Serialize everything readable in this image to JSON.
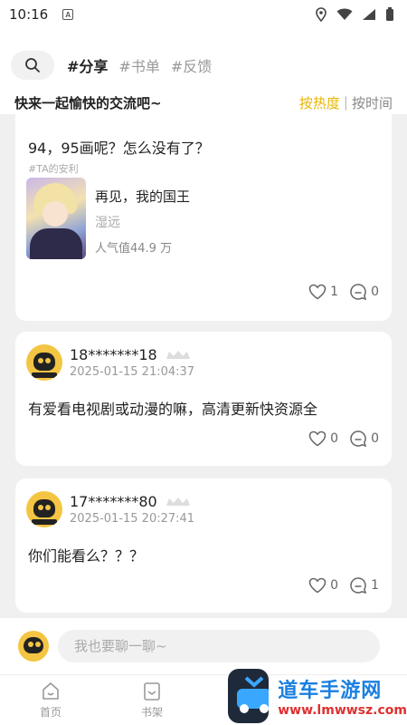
{
  "status": {
    "time": "10:16",
    "app_icon_glyph": "A"
  },
  "tabs": [
    {
      "label": "#分享",
      "active": true
    },
    {
      "label": "#书单",
      "active": false
    },
    {
      "label": "#反馈",
      "active": false
    }
  ],
  "subheader": {
    "title": "快来一起愉快的交流吧~",
    "sort_hot": "按热度",
    "sort_time": "按时间"
  },
  "posts": [
    {
      "text": "94，95画呢？怎么没有了？",
      "topic_tag": "#TA的安利",
      "book": {
        "title": "再见，我的国王",
        "author": "湿远",
        "popularity": "人气值44.9 万"
      },
      "likes": "1",
      "comments": "0"
    },
    {
      "user": "18*******18",
      "time": "2025-01-15 21:04:37",
      "text": "有爱看电视剧或动漫的嘛，高清更新快资源全",
      "likes": "0",
      "comments": "0"
    },
    {
      "user": "17*******80",
      "time": "2025-01-15 20:27:41",
      "text": "你们能看么？？？",
      "likes": "0",
      "comments": "1"
    }
  ],
  "input": {
    "placeholder": "我也要聊一聊~"
  },
  "nav": [
    {
      "label": "首页"
    },
    {
      "label": "书架"
    }
  ],
  "watermark": {
    "title": "道车手游网",
    "url": "www.lmwwsz.com"
  },
  "colors": {
    "accent": "#e8b500",
    "feed_bg": "#f0f0f0"
  }
}
